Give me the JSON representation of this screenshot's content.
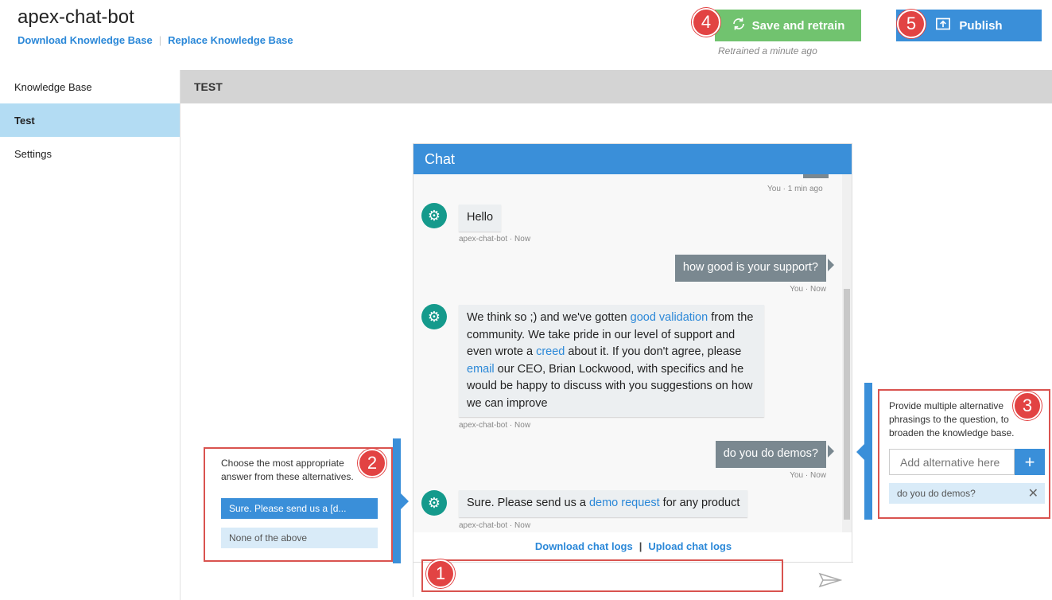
{
  "header": {
    "app_title": "apex-chat-bot",
    "download_kb": "Download Knowledge Base",
    "replace_kb": "Replace Knowledge Base",
    "save_retrain": "Save and retrain",
    "retrain_note": "Retrained a minute ago",
    "publish": "Publish"
  },
  "callouts": {
    "c1": "1",
    "c2": "2",
    "c3": "3",
    "c4": "4",
    "c5": "5"
  },
  "sidebar": {
    "items": [
      {
        "label": "Knowledge Base"
      },
      {
        "label": "Test",
        "active": true
      },
      {
        "label": "Settings"
      }
    ]
  },
  "section": {
    "title": "TEST"
  },
  "chat": {
    "title": "Chat",
    "top_time": "You · 1 min ago",
    "m1": {
      "text": "Hello",
      "time": "apex-chat-bot · Now"
    },
    "m2": {
      "text": "how good is your support?",
      "time": "You · Now"
    },
    "m3": {
      "t1": "We think so ;) and we've gotten ",
      "l1": "good validation",
      "t2": " from the community. We take pride in our level of support and even wrote a ",
      "l2": "creed",
      "t3": " about it. If you don't agree, please ",
      "l3": "email",
      "t4": " our CEO, Brian Lockwood, with specifics and he would be happy to discuss with you suggestions on how we can improve",
      "time": "apex-chat-bot · Now"
    },
    "m4": {
      "text": "do you do demos?",
      "time": "You · Now"
    },
    "m5": {
      "t1": "Sure. Please send us a ",
      "l1": "demo request",
      "t2": " for any product",
      "time": "apex-chat-bot · Now"
    },
    "download_logs": "Download chat logs",
    "footer_sep": "|",
    "upload_logs": "Upload chat logs"
  },
  "alternatives_panel": {
    "hint": "Choose the most appropriate answer from these alternatives.",
    "option_selected": "Sure. Please send us a [d...",
    "option_none": "None of the above"
  },
  "phrasing_panel": {
    "hint": "Provide multiple alternative phrasings to the question, to broaden the knowledge base.",
    "input_placeholder": "Add alternative here",
    "chip": "do you do demos?"
  }
}
